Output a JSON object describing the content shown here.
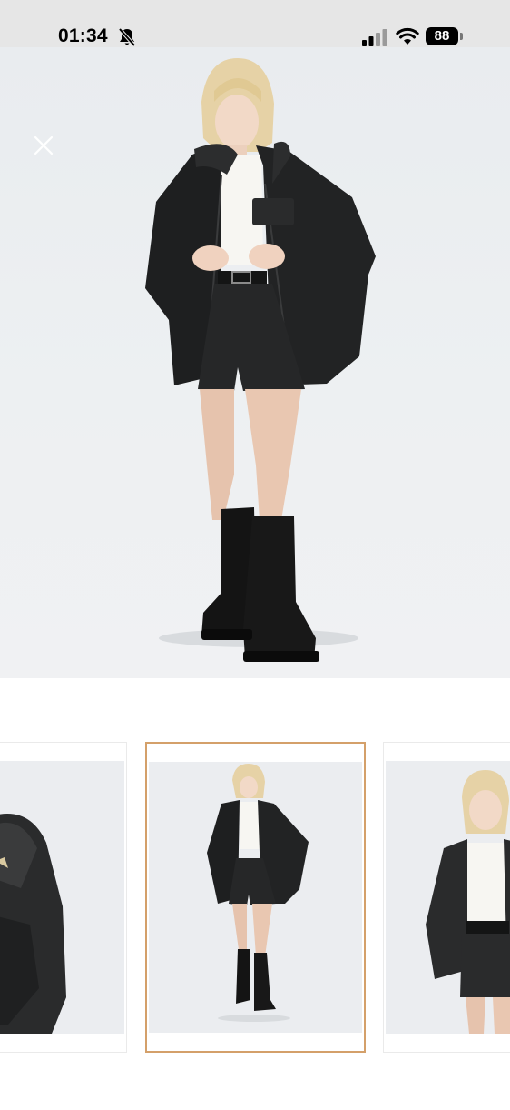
{
  "status_bar": {
    "time": "01:34",
    "battery": "88",
    "icons": [
      "bell-slash-icon",
      "cellular-signal-icon",
      "wifi-icon",
      "battery-icon"
    ]
  },
  "viewer": {
    "close_icon": "close-icon",
    "accent_color": "#d4a06a",
    "background_color": "#ffffff",
    "thumbnails": [
      {
        "view": "back-side",
        "selected": false
      },
      {
        "view": "front-full",
        "selected": true
      },
      {
        "view": "front-crop",
        "selected": false
      }
    ]
  }
}
